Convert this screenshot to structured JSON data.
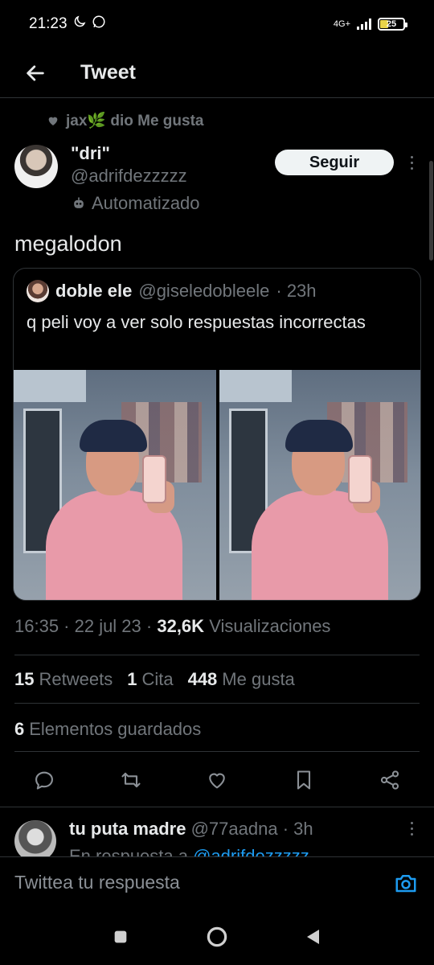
{
  "status_bar": {
    "time": "21:23",
    "network": "4G+",
    "battery": "25"
  },
  "header": {
    "title": "Tweet"
  },
  "tweet": {
    "social_context": "jax🌿 dio Me gusta",
    "author_name": "\"dri\"",
    "author_handle": "@adrifdezzzzz",
    "automated_label": "Automatizado",
    "follow_label": "Seguir",
    "text": "megalodon",
    "quote": {
      "author_name": "doble ele",
      "author_handle": "@giseledobleele",
      "time": "· 23h",
      "text": "q peli voy a ver solo respuestas incorrectas"
    },
    "timestamp": "16:35 · 22 jul 23 · ",
    "views_count": "32,6K",
    "views_label": "Visualizaciones",
    "stats": {
      "retweets_count": "15",
      "retweets_label": "Retweets",
      "quotes_count": "1",
      "quotes_label": "Cita",
      "likes_count": "448",
      "likes_label": "Me gusta"
    },
    "bookmarks_count": "6",
    "bookmarks_label": "Elementos guardados"
  },
  "reply": {
    "author_name": "tu puta madre",
    "author_handle": "@77aadna",
    "time": "· 3h",
    "replying_prefix": "En respuesta a ",
    "replying_to": "@adrifdezzzzz"
  },
  "composer": {
    "placeholder": "Twittea tu respuesta"
  },
  "colors": {
    "background": "#000000",
    "accent": "#1d9bf0",
    "text_primary": "#e7e9ea",
    "text_secondary": "#71767b",
    "border": "#2f3336"
  }
}
